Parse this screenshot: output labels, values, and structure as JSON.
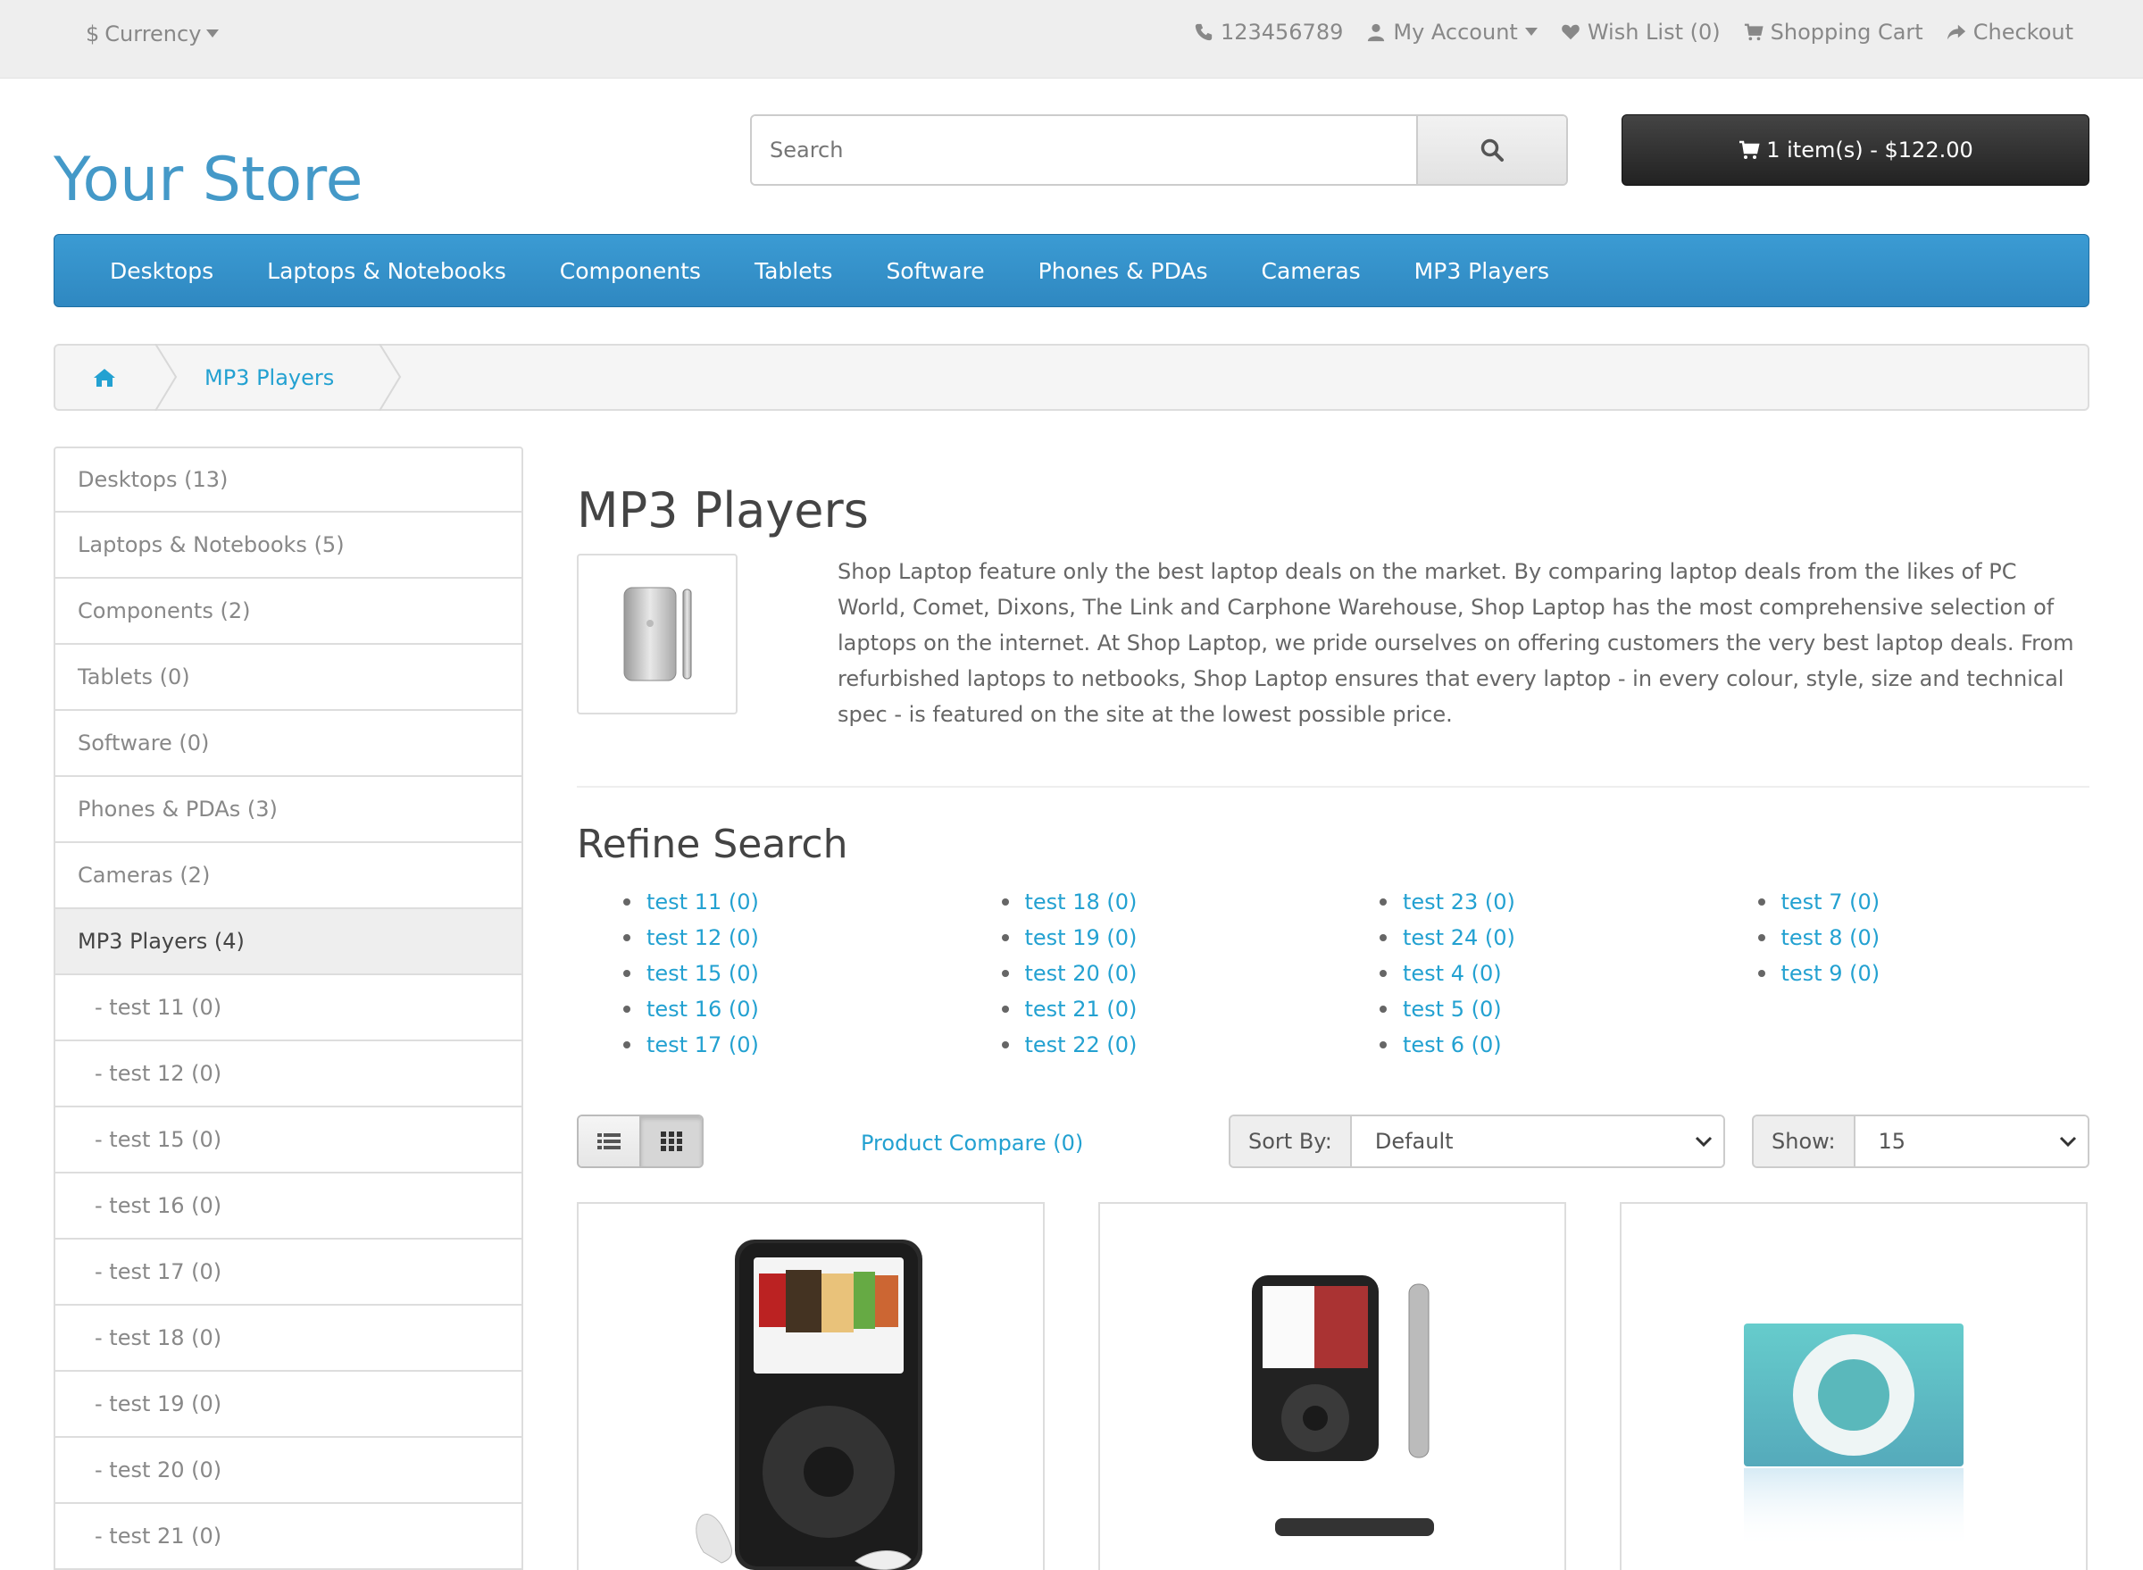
{
  "topbar": {
    "currency_symbol": "$",
    "currency_label": "Currency",
    "phone": "123456789",
    "my_account": "My Account",
    "wish_list": "Wish List (0)",
    "shopping_cart": "Shopping Cart",
    "checkout": "Checkout"
  },
  "header": {
    "logo": "Your Store",
    "search_placeholder": "Search",
    "cart_label": "1 item(s) - $122.00"
  },
  "menu": {
    "items": [
      "Desktops",
      "Laptops & Notebooks",
      "Components",
      "Tablets",
      "Software",
      "Phones & PDAs",
      "Cameras",
      "MP3 Players"
    ]
  },
  "breadcrumb": {
    "current": "MP3 Players"
  },
  "sidebar": {
    "items": [
      {
        "label": "Desktops (13)"
      },
      {
        "label": "Laptops & Notebooks (5)"
      },
      {
        "label": "Components (2)"
      },
      {
        "label": "Tablets (0)"
      },
      {
        "label": "Software (0)"
      },
      {
        "label": "Phones & PDAs (3)"
      },
      {
        "label": "Cameras (2)"
      },
      {
        "label": "MP3 Players (4)"
      },
      {
        "label": "- test 11 (0)"
      },
      {
        "label": "- test 12 (0)"
      },
      {
        "label": "- test 15 (0)"
      },
      {
        "label": "- test 16 (0)"
      },
      {
        "label": "- test 17 (0)"
      },
      {
        "label": "- test 18 (0)"
      },
      {
        "label": "- test 19 (0)"
      },
      {
        "label": "- test 20 (0)"
      },
      {
        "label": "- test 21 (0)"
      }
    ]
  },
  "category": {
    "title": "MP3 Players",
    "description": "Shop Laptop feature only the best laptop deals on the market. By comparing laptop deals from the likes of PC World, Comet, Dixons, The Link and Carphone Warehouse, Shop Laptop has the most comprehensive selection of laptops on the internet. At Shop Laptop, we pride ourselves on offering customers the very best laptop deals. From refurbished laptops to netbooks, Shop Laptop ensures that every laptop - in every colour, style, size and technical spec - is featured on the site at the lowest possible price."
  },
  "refine": {
    "title": "Refine Search",
    "columns": [
      [
        "test 11 (0)",
        "test 12 (0)",
        "test 15 (0)",
        "test 16 (0)",
        "test 17 (0)"
      ],
      [
        "test 18 (0)",
        "test 19 (0)",
        "test 20 (0)",
        "test 21 (0)",
        "test 22 (0)"
      ],
      [
        "test 23 (0)",
        "test 24 (0)",
        "test 4 (0)",
        "test 5 (0)",
        "test 6 (0)"
      ],
      [
        "test 7 (0)",
        "test 8 (0)",
        "test 9 (0)"
      ]
    ]
  },
  "toolbar": {
    "compare": "Product Compare (0)",
    "sort_label": "Sort By:",
    "sort_value": "Default",
    "show_label": "Show:",
    "show_value": "15"
  },
  "icons": {
    "phone": "phone-icon",
    "account": "user-icon",
    "wish": "heart-icon",
    "cart": "cart-icon",
    "checkout": "share-icon",
    "search": "search-icon",
    "home": "home-icon"
  },
  "colors": {
    "brand": "#4499c8",
    "menu": "#3390c8",
    "link": "#23a1d1"
  }
}
